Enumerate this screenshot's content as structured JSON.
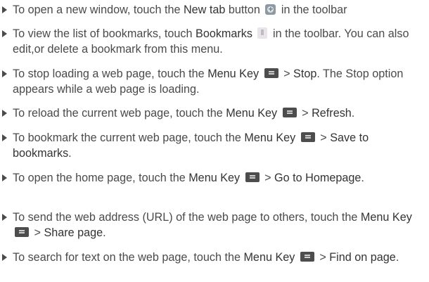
{
  "icons": {
    "new_tab": "new-tab-icon",
    "bookmarks": "bookmark-icon",
    "menu_key": "menu-key-icon"
  },
  "items": [
    {
      "t1": "To open a new window, touch the ",
      "b1": "New tab",
      "t2": " button ",
      "t3": " in the toolbar"
    },
    {
      "t1": "To view the list of bookmarks, touch ",
      "b1": "Bookmarks",
      "t2": " in the toolbar. You can also edit,or delete a bookmark from this menu."
    },
    {
      "t1": "To stop loading a web page, touch the ",
      "b1": "Menu Key",
      "t2": " > ",
      "b2": "Stop",
      "t3": ". The Stop option appears while a web page is loading."
    },
    {
      "t1": "To reload the current web page, touch the ",
      "b1": "Menu Key",
      "t2": " > ",
      "b2": "Refresh",
      "t3": "."
    },
    {
      "t1": "To bookmark the current web page, touch the ",
      "b1": "Menu Key",
      "t2": " > ",
      "b2": "Save to bookmarks",
      "t3": "."
    },
    {
      "t1": "To open the home page, touch the ",
      "b1": "Menu Key",
      "t2": " > ",
      "b2": "Go to Homepage",
      "t3": "."
    },
    {
      "t1": "To send the web address (URL) of the web page to others, touch the ",
      "b1": "Menu Key",
      "t2": " > ",
      "b2": "Share page",
      "t3": "."
    },
    {
      "t1": "To search for text on the web page, touch the ",
      "b1": "Menu Key",
      "t2": " > ",
      "b2": "Find on page",
      "t3": "."
    }
  ]
}
